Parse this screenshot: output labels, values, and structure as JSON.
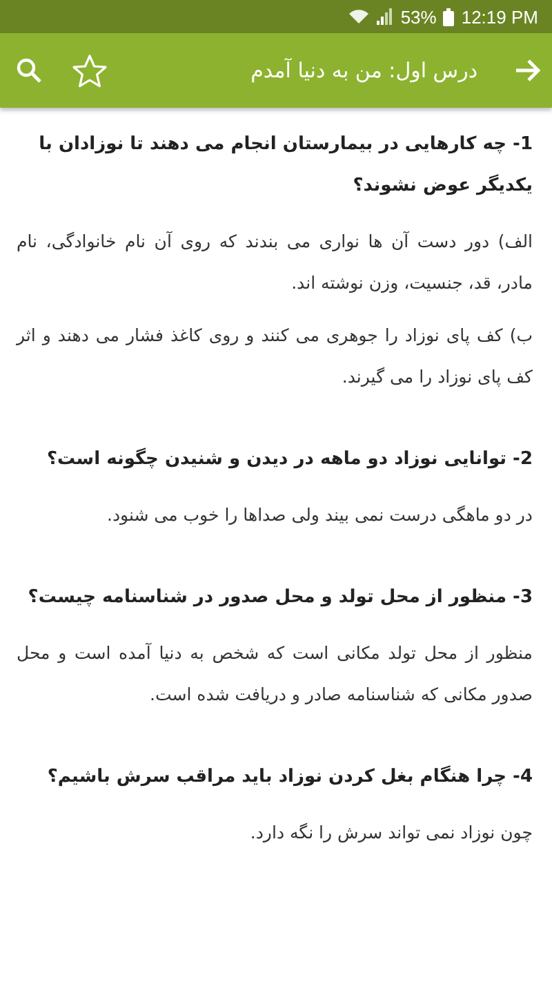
{
  "status_bar": {
    "battery": "53%",
    "time": "12:19 PM"
  },
  "app_bar": {
    "title": "درس اول: من به دنیا آمدم"
  },
  "sections": [
    {
      "question": "1- چه کارهایی در بیمارستان انجام می دهند تا نوزادان با یکدیگر عوض نشوند؟",
      "answers": [
        "الف) دور دست آن ها نواری می بندند که روی آن نام خانوادگی، نام مادر، قد، جنسیت، وزن نوشته اند.",
        "ب) کف پای نوزاد را جوهری می کنند و روی کاغذ فشار می دهند و اثر کف پای نوزاد را می گیرند."
      ]
    },
    {
      "question": "2- توانایی نوزاد دو ماهه در دیدن و شنیدن چگونه است؟",
      "answers": [
        "در دو ماهگی درست نمی بیند ولی صداها را خوب می شنود."
      ]
    },
    {
      "question": "3- منظور از محل تولد و محل صدور در شناسنامه چیست؟",
      "answers": [
        "منظور از محل تولد مکانی است که شخص به دنیا آمده است و محل صدور مکانی که شناسنامه صادر و دریافت شده است."
      ]
    },
    {
      "question": "4- چرا هنگام بغل کردن نوزاد باید مراقب سرش باشیم؟",
      "answers": [
        "چون نوزاد نمی تواند سرش را نگه دارد."
      ]
    }
  ]
}
